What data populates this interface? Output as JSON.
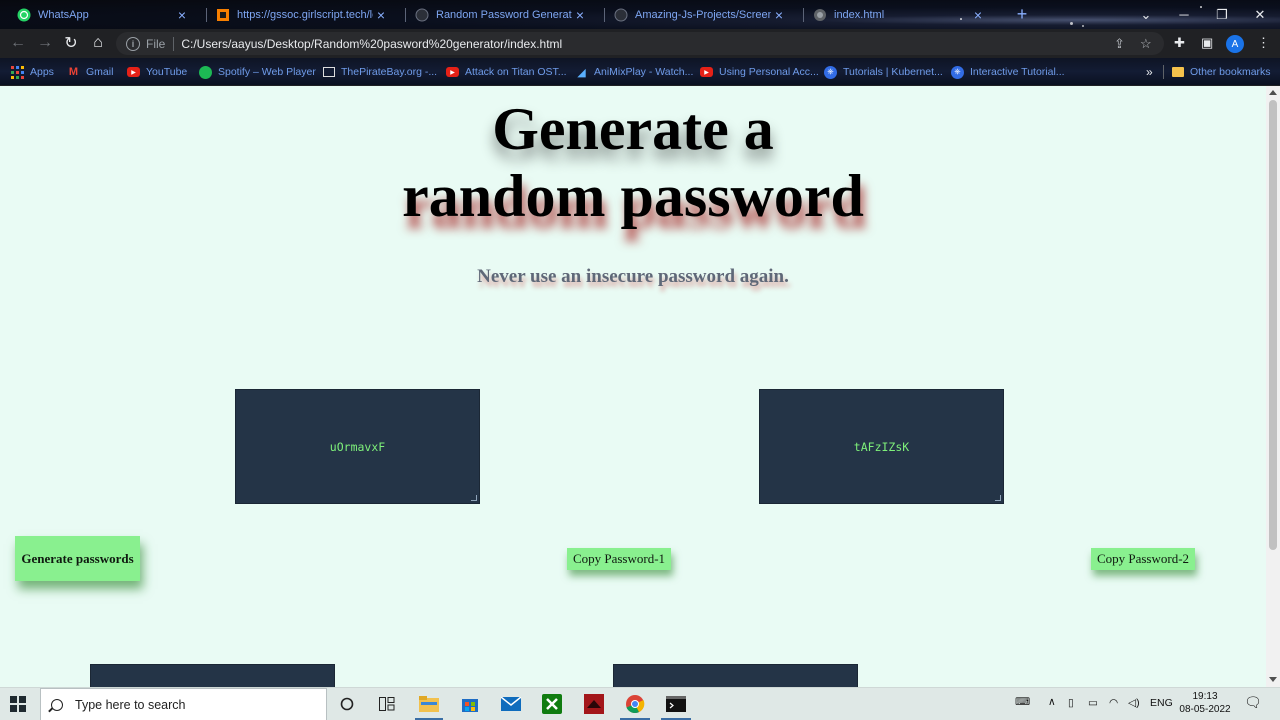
{
  "browser": {
    "tabs": [
      {
        "label": "WhatsApp",
        "icon": "whatsapp-icon"
      },
      {
        "label": "https://gssoc.girlscript.tech/leade",
        "icon": "gssoc-icon"
      },
      {
        "label": "Random Password Generator - Js",
        "icon": "github-icon"
      },
      {
        "label": "Amazing-Js-Projects/Screen disc",
        "icon": "github-icon"
      },
      {
        "label": "index.html",
        "icon": "globe-icon"
      }
    ],
    "address": {
      "scheme_label": "File",
      "url": "C:/Users/aayus/Desktop/Random%20pasword%20generator/index.html"
    },
    "profile_initial": "A",
    "bookmarks": [
      {
        "label": "Apps",
        "icon": "apps-grid-icon"
      },
      {
        "label": "Gmail",
        "icon": "gmail-icon"
      },
      {
        "label": "YouTube",
        "icon": "youtube-icon"
      },
      {
        "label": "Spotify – Web Player",
        "icon": "spotify-icon"
      },
      {
        "label": "ThePirateBay.org -...",
        "icon": "piratebay-icon"
      },
      {
        "label": "Attack on Titan OST...",
        "icon": "youtube-icon"
      },
      {
        "label": "AniMixPlay - Watch...",
        "icon": "animixplay-icon"
      },
      {
        "label": "Using Personal Acc...",
        "icon": "youtube-icon"
      },
      {
        "label": "Tutorials | Kubernet...",
        "icon": "kubernetes-icon"
      },
      {
        "label": "Interactive Tutorial...",
        "icon": "kubernetes-icon"
      }
    ],
    "overflow_label": "»",
    "other_bookmarks": "Other bookmarks"
  },
  "page": {
    "heading_line1": "Generate a",
    "heading_line2": "random password",
    "subtitle": "Never use an insecure password again.",
    "password_1": "uOrmavxF",
    "password_2": "tAFzIZsK",
    "generate_label": "Generate passwords",
    "copy_1_label": "Copy Password-1",
    "copy_2_label": "Copy Password-2"
  },
  "taskbar": {
    "search_placeholder": "Type here to search",
    "language": "ENG",
    "time": "19:13",
    "date": "08-05-2022"
  },
  "colors": {
    "page_bg": "#e9fbf4",
    "box_bg": "#243447",
    "password_text": "#7ef07a",
    "button_bg": "#89f08f"
  }
}
